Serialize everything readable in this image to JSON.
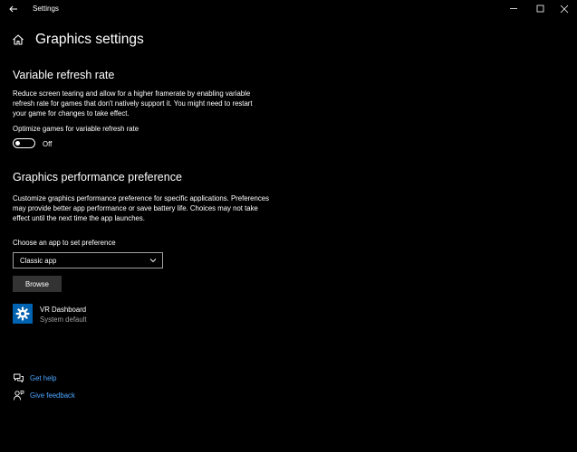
{
  "window": {
    "title": "Settings"
  },
  "page": {
    "title": "Graphics settings"
  },
  "variable_refresh_rate": {
    "heading": "Variable refresh rate",
    "description": "Reduce screen tearing and allow for a higher framerate by enabling variable refresh rate for games that don't natively support it. You might need to restart your game for changes to take effect.",
    "toggle_label": "Optimize games for variable refresh rate",
    "toggle_state": "Off"
  },
  "graphics_preference": {
    "heading": "Graphics performance preference",
    "description": "Customize graphics performance preference for specific applications. Preferences may provide better app performance or save battery life. Choices may not take effect until the next time the app launches.",
    "choose_label": "Choose an app to set preference",
    "selected_app_type": "Classic app",
    "browse_label": "Browse"
  },
  "apps": [
    {
      "name": "VR Dashboard",
      "preference": "System default",
      "icon": "gear-icon"
    }
  ],
  "links": {
    "help": "Get help",
    "feedback": "Give feedback"
  },
  "colors": {
    "background": "#000000",
    "accent": "#0063b1",
    "link": "#4ca5ff",
    "secondary_text": "#a0a0a0",
    "button": "#333333"
  }
}
